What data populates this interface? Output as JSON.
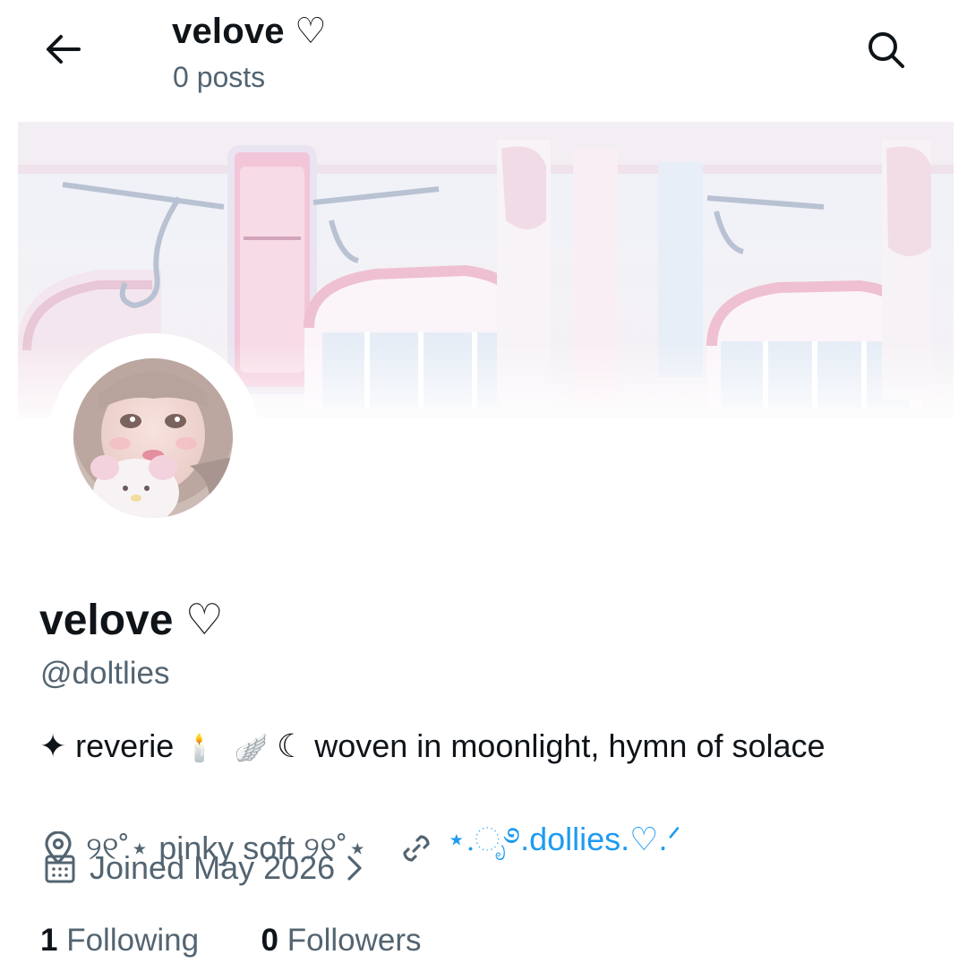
{
  "header": {
    "title": "velove ♡",
    "posts": "0 posts",
    "back_icon": "arrow-left-icon",
    "search_icon": "search-icon"
  },
  "profile": {
    "display_name": "velove ♡",
    "handle": "@doltlies",
    "bio": {
      "star": "✦",
      "part1": " reverie ",
      "candle": "🕯️",
      "wing": "🪽",
      "part2": " ☾ woven in moonlight, hymn of solace"
    },
    "location": "୨୧˚⋆ pinky soft ୨୧˚⋆",
    "link": "⋆.ೃ࿔.dollies.♡.ᐟ",
    "joined": "Joined May 2026",
    "following_count": "1",
    "following_label": "Following",
    "followers_count": "0",
    "followers_label": "Followers"
  },
  "colors": {
    "text": "#0f1419",
    "muted": "#536471",
    "link": "#1d9bf0",
    "banner_tint": "#f7eaf2"
  }
}
